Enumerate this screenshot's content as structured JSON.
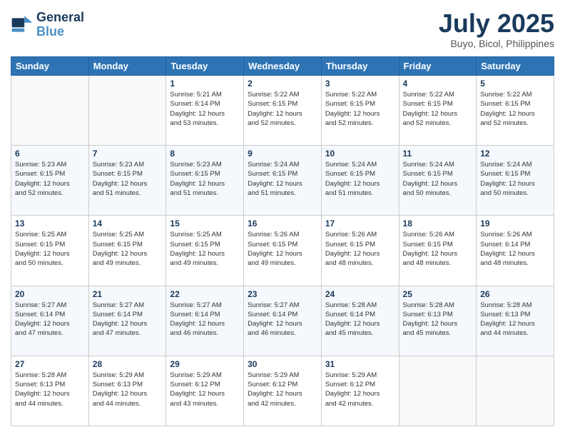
{
  "header": {
    "logo_line1": "General",
    "logo_line2": "Blue",
    "month": "July 2025",
    "location": "Buyo, Bicol, Philippines"
  },
  "weekdays": [
    "Sunday",
    "Monday",
    "Tuesday",
    "Wednesday",
    "Thursday",
    "Friday",
    "Saturday"
  ],
  "weeks": [
    [
      {
        "day": "",
        "info": ""
      },
      {
        "day": "",
        "info": ""
      },
      {
        "day": "1",
        "info": "Sunrise: 5:21 AM\nSunset: 6:14 PM\nDaylight: 12 hours\nand 53 minutes."
      },
      {
        "day": "2",
        "info": "Sunrise: 5:22 AM\nSunset: 6:15 PM\nDaylight: 12 hours\nand 52 minutes."
      },
      {
        "day": "3",
        "info": "Sunrise: 5:22 AM\nSunset: 6:15 PM\nDaylight: 12 hours\nand 52 minutes."
      },
      {
        "day": "4",
        "info": "Sunrise: 5:22 AM\nSunset: 6:15 PM\nDaylight: 12 hours\nand 52 minutes."
      },
      {
        "day": "5",
        "info": "Sunrise: 5:22 AM\nSunset: 6:15 PM\nDaylight: 12 hours\nand 52 minutes."
      }
    ],
    [
      {
        "day": "6",
        "info": "Sunrise: 5:23 AM\nSunset: 6:15 PM\nDaylight: 12 hours\nand 52 minutes."
      },
      {
        "day": "7",
        "info": "Sunrise: 5:23 AM\nSunset: 6:15 PM\nDaylight: 12 hours\nand 51 minutes."
      },
      {
        "day": "8",
        "info": "Sunrise: 5:23 AM\nSunset: 6:15 PM\nDaylight: 12 hours\nand 51 minutes."
      },
      {
        "day": "9",
        "info": "Sunrise: 5:24 AM\nSunset: 6:15 PM\nDaylight: 12 hours\nand 51 minutes."
      },
      {
        "day": "10",
        "info": "Sunrise: 5:24 AM\nSunset: 6:15 PM\nDaylight: 12 hours\nand 51 minutes."
      },
      {
        "day": "11",
        "info": "Sunrise: 5:24 AM\nSunset: 6:15 PM\nDaylight: 12 hours\nand 50 minutes."
      },
      {
        "day": "12",
        "info": "Sunrise: 5:24 AM\nSunset: 6:15 PM\nDaylight: 12 hours\nand 50 minutes."
      }
    ],
    [
      {
        "day": "13",
        "info": "Sunrise: 5:25 AM\nSunset: 6:15 PM\nDaylight: 12 hours\nand 50 minutes."
      },
      {
        "day": "14",
        "info": "Sunrise: 5:25 AM\nSunset: 6:15 PM\nDaylight: 12 hours\nand 49 minutes."
      },
      {
        "day": "15",
        "info": "Sunrise: 5:25 AM\nSunset: 6:15 PM\nDaylight: 12 hours\nand 49 minutes."
      },
      {
        "day": "16",
        "info": "Sunrise: 5:26 AM\nSunset: 6:15 PM\nDaylight: 12 hours\nand 49 minutes."
      },
      {
        "day": "17",
        "info": "Sunrise: 5:26 AM\nSunset: 6:15 PM\nDaylight: 12 hours\nand 48 minutes."
      },
      {
        "day": "18",
        "info": "Sunrise: 5:26 AM\nSunset: 6:15 PM\nDaylight: 12 hours\nand 48 minutes."
      },
      {
        "day": "19",
        "info": "Sunrise: 5:26 AM\nSunset: 6:14 PM\nDaylight: 12 hours\nand 48 minutes."
      }
    ],
    [
      {
        "day": "20",
        "info": "Sunrise: 5:27 AM\nSunset: 6:14 PM\nDaylight: 12 hours\nand 47 minutes."
      },
      {
        "day": "21",
        "info": "Sunrise: 5:27 AM\nSunset: 6:14 PM\nDaylight: 12 hours\nand 47 minutes."
      },
      {
        "day": "22",
        "info": "Sunrise: 5:27 AM\nSunset: 6:14 PM\nDaylight: 12 hours\nand 46 minutes."
      },
      {
        "day": "23",
        "info": "Sunrise: 5:27 AM\nSunset: 6:14 PM\nDaylight: 12 hours\nand 46 minutes."
      },
      {
        "day": "24",
        "info": "Sunrise: 5:28 AM\nSunset: 6:14 PM\nDaylight: 12 hours\nand 45 minutes."
      },
      {
        "day": "25",
        "info": "Sunrise: 5:28 AM\nSunset: 6:13 PM\nDaylight: 12 hours\nand 45 minutes."
      },
      {
        "day": "26",
        "info": "Sunrise: 5:28 AM\nSunset: 6:13 PM\nDaylight: 12 hours\nand 44 minutes."
      }
    ],
    [
      {
        "day": "27",
        "info": "Sunrise: 5:28 AM\nSunset: 6:13 PM\nDaylight: 12 hours\nand 44 minutes."
      },
      {
        "day": "28",
        "info": "Sunrise: 5:29 AM\nSunset: 6:13 PM\nDaylight: 12 hours\nand 44 minutes."
      },
      {
        "day": "29",
        "info": "Sunrise: 5:29 AM\nSunset: 6:12 PM\nDaylight: 12 hours\nand 43 minutes."
      },
      {
        "day": "30",
        "info": "Sunrise: 5:29 AM\nSunset: 6:12 PM\nDaylight: 12 hours\nand 42 minutes."
      },
      {
        "day": "31",
        "info": "Sunrise: 5:29 AM\nSunset: 6:12 PM\nDaylight: 12 hours\nand 42 minutes."
      },
      {
        "day": "",
        "info": ""
      },
      {
        "day": "",
        "info": ""
      }
    ]
  ]
}
